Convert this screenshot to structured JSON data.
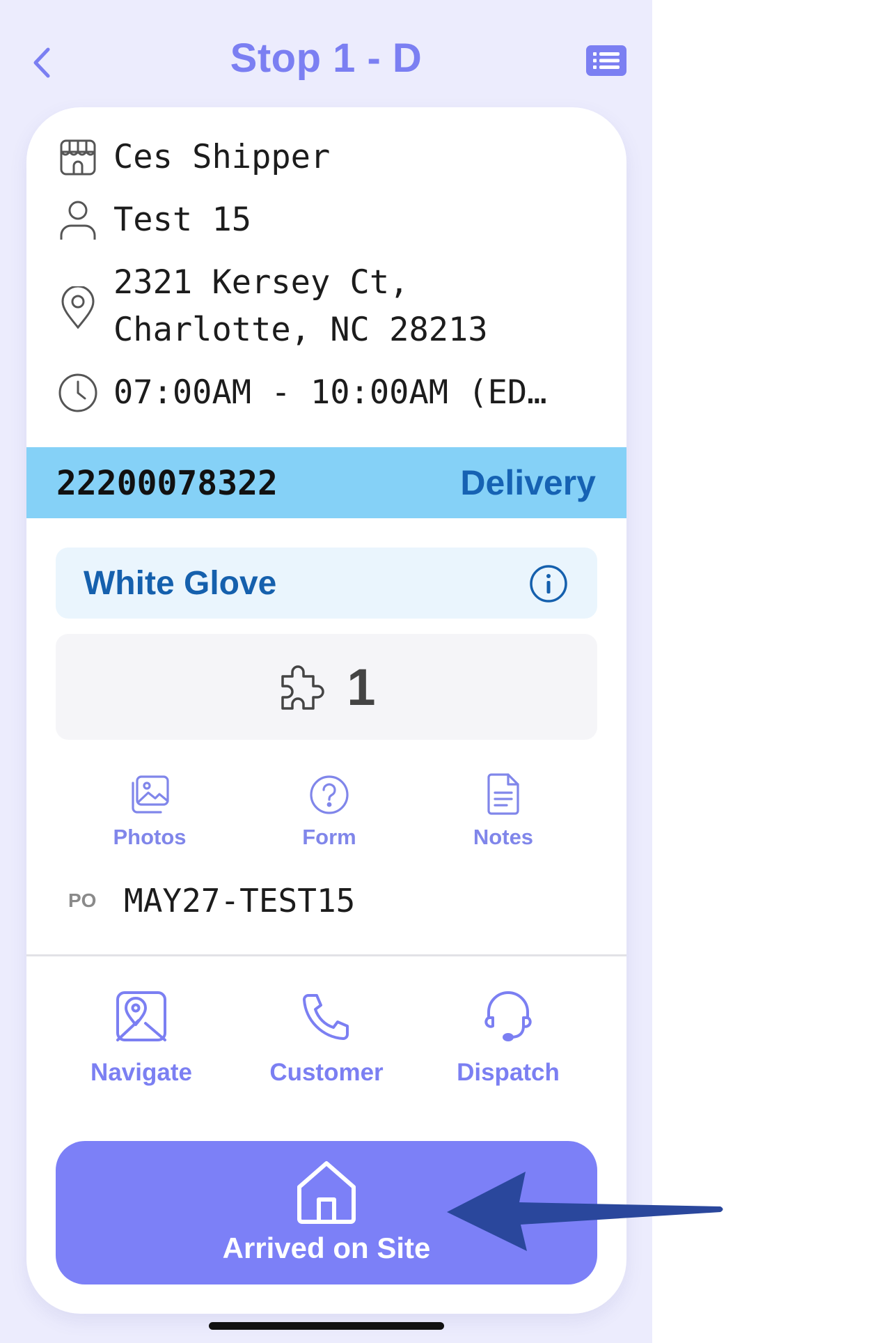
{
  "header": {
    "title": "Stop 1 - D",
    "back_icon": "chevron-left-icon",
    "menu_icon": "list-icon"
  },
  "stop": {
    "shipper": "Ces Shipper",
    "contact": "Test 15",
    "address_line1": "2321 Kersey Ct,",
    "address_line2": "Charlotte, NC 28213",
    "time_window": "07:00AM - 10:00AM (ED…"
  },
  "order": {
    "number": "22200078322",
    "type": "Delivery"
  },
  "service": {
    "label": "White Glove",
    "info_icon": "info-icon"
  },
  "pieces": {
    "count": "1",
    "icon": "puzzle-icon"
  },
  "quick_actions": [
    {
      "label": "Photos",
      "icon": "photos-icon"
    },
    {
      "label": "Form",
      "icon": "question-icon"
    },
    {
      "label": "Notes",
      "icon": "document-icon"
    }
  ],
  "po": {
    "label": "PO",
    "value": "MAY27-TEST15"
  },
  "contact_actions": [
    {
      "label": "Navigate",
      "icon": "map-icon"
    },
    {
      "label": "Customer",
      "icon": "phone-icon"
    },
    {
      "label": "Dispatch",
      "icon": "headset-icon"
    }
  ],
  "primary_action": {
    "label": "Arrived on Site",
    "icon": "home-icon"
  },
  "colors": {
    "accent": "#7c80f7",
    "order_bar": "#85d1f7",
    "order_type": "#1662b3",
    "background": "#ececfd"
  }
}
